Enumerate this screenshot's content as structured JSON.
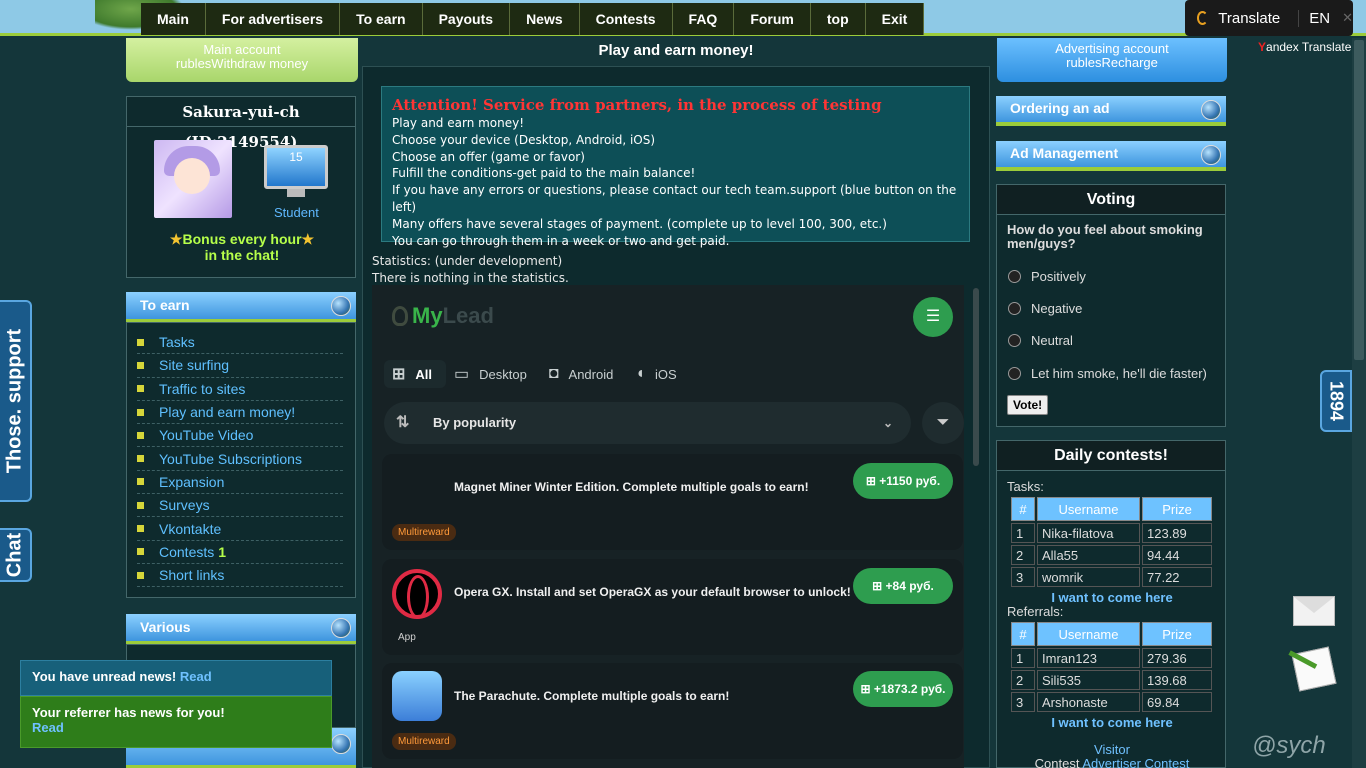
{
  "nav": [
    "Main",
    "For advertisers",
    "To earn",
    "Payouts",
    "News",
    "Contests",
    "FAQ",
    "Forum",
    "top",
    "Exit"
  ],
  "translate": {
    "label": "Translate",
    "lang": "EN",
    "close": "✕",
    "credit_y": "Y",
    "credit_rest": "andex Translate"
  },
  "left": {
    "account_line1": "Main account",
    "account_line2": "rublesWithdraw money",
    "username": "Sakura-yui-ch",
    "user_id": "(ID:2149554)",
    "level": "15",
    "level_title": "Student",
    "bonus_line1": "Bonus every hour",
    "bonus_line2": "in the chat!",
    "to_earn_title": "To earn",
    "earn_items": [
      {
        "label": "Tasks",
        "count": ""
      },
      {
        "label": "Site surfing",
        "count": ""
      },
      {
        "label": "Traffic to sites",
        "count": ""
      },
      {
        "label": "Play and earn money!",
        "count": ""
      },
      {
        "label": "YouTube Video",
        "count": ""
      },
      {
        "label": "YouTube Subscriptions",
        "count": ""
      },
      {
        "label": "Expansion",
        "count": ""
      },
      {
        "label": "Surveys",
        "count": ""
      },
      {
        "label": "Vkontakte",
        "count": ""
      },
      {
        "label": "Contests",
        "count": "1"
      },
      {
        "label": "Short links",
        "count": ""
      }
    ],
    "various_title": "Various",
    "support_tab": "Those. support",
    "chat_tab": "Chat",
    "notice1_text": "You have unread news!",
    "notice1_link": "Read",
    "notice2_text": "Your referrer has news for you!",
    "notice2_link": "Read"
  },
  "center": {
    "title": "Play and earn money!",
    "attention_title": "Attention! Service from partners, in the process of testing",
    "attention_lines": [
      "Play and earn money!",
      "Choose your device (Desktop, Android, iOS)",
      "Choose an offer (game or favor)",
      "Fulfill the conditions-get paid to the main balance!",
      "If you have any errors or questions, please contact our tech team.support (blue button on the left)",
      "Many offers have several stages of payment. (complete up to level 100, 300, etc.)",
      "You can go through them in a week or two and get paid."
    ],
    "stats_line1": "Statistics: (under development)",
    "stats_line2": "There is nothing in the statistics.",
    "mylead": {
      "logo_my": "My",
      "logo_lead": "Lead",
      "menu_icon": "☰",
      "filters": [
        {
          "label": "All",
          "icon": "grid-icon"
        },
        {
          "label": "Desktop",
          "icon": "monitor-icon"
        },
        {
          "label": "Android",
          "icon": "android-icon"
        },
        {
          "label": "iOS",
          "icon": "apple-icon"
        }
      ],
      "sort_label": "By popularity",
      "offers": [
        {
          "title": "Magnet Miner Winter Edition. Complete multiple goals to earn!",
          "price": "+1150 руб.",
          "badge": "Multireward"
        },
        {
          "title": "Opera GX. Install and set OperaGX as your default browser to unlock!",
          "price": "+84 руб.",
          "badge": "App"
        },
        {
          "title": "The Parachute. Complete multiple goals to earn!",
          "price": "+1873.2 руб.",
          "badge": "Multireward"
        }
      ]
    }
  },
  "right": {
    "adv_line1": "Advertising account",
    "adv_line2": "rublesRecharge",
    "ordering_title": "Ordering an ad",
    "ad_mgmt_title": "Ad Management",
    "voting_title": "Voting",
    "question": "How do you feel about smoking men/guys?",
    "options": [
      "Positively",
      "Negative",
      "Neutral",
      "Let him smoke, he'll die faster)"
    ],
    "vote_button": "Vote!",
    "contests_title": "Daily contests!",
    "tasks_label": "Tasks:",
    "referrals_label": "Referrals:",
    "headers": [
      "#",
      "Username",
      "Prize"
    ],
    "tasks_rows": [
      [
        "1",
        "Nika-filatova",
        "123.89"
      ],
      [
        "2",
        "Alla55",
        "94.44"
      ],
      [
        "3",
        "womrik",
        "77.22"
      ]
    ],
    "ref_rows": [
      [
        "1",
        "Imran123",
        "279.36"
      ],
      [
        "2",
        "Sili535",
        "139.68"
      ],
      [
        "3",
        "Arshonaste",
        "69.84"
      ]
    ],
    "come_here": "I want to come here",
    "visitor": "Visitor",
    "contest_word": "Contest",
    "adv_contest": "Advertiser Contest"
  },
  "badge_count": "1894",
  "watermark": "@sych",
  "colors": {
    "accent_green": "#9ccc3a",
    "offer_green": "#2e9d4f",
    "blue": "#3e95de",
    "alert_red": "#ff3535"
  }
}
